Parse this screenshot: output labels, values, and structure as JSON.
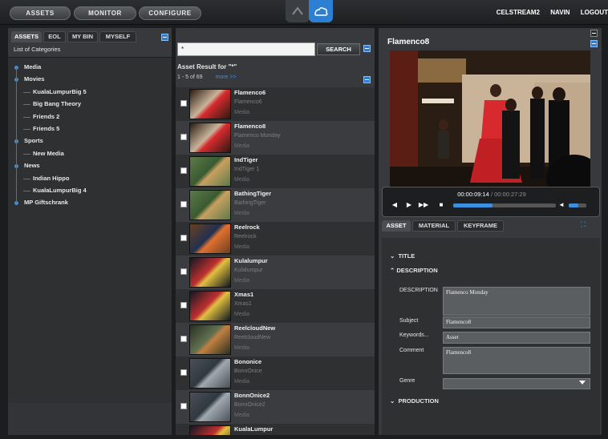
{
  "nav": {
    "buttons": [
      "ASSETS",
      "MONITOR",
      "CONFIGURE"
    ],
    "user_items": [
      "CELSTREAM2",
      "NAVIN",
      "LOGOUT"
    ]
  },
  "left_panel": {
    "tabs": [
      "ASSETS",
      "EOL",
      "MY BIN",
      "MYSELF"
    ],
    "heading": "List of Categories",
    "tree": [
      {
        "label": "Media",
        "level": 0
      },
      {
        "label": "Movies",
        "level": 0
      },
      {
        "label": "KualaLumpurBig 5",
        "level": 1
      },
      {
        "label": "Big Bang Theory",
        "level": 1
      },
      {
        "label": "Friends 2",
        "level": 1
      },
      {
        "label": "Friends 5",
        "level": 1
      },
      {
        "label": "Sports",
        "level": 0
      },
      {
        "label": "New Media",
        "level": 1
      },
      {
        "label": "News",
        "level": 0
      },
      {
        "label": "Indian Hippo",
        "level": 1
      },
      {
        "label": "KualaLumpurBig 4",
        "level": 1
      },
      {
        "label": "MP Giftschrank",
        "level": 0
      }
    ]
  },
  "middle_panel": {
    "search_value": "*",
    "search_label": "SEARCH",
    "result_heading": "Asset Result for \"*\"",
    "result_count": "1 - 5 of 69",
    "more_link": "more >>",
    "results": [
      {
        "name": "Flamenco6",
        "sub": "Flamenco6",
        "type": "Media",
        "thumb": "flamenco"
      },
      {
        "name": "Flamenco8",
        "sub": "Flamenco Monday",
        "type": "Media",
        "thumb": "flamenco"
      },
      {
        "name": "IndTiger",
        "sub": "IndTiger 1",
        "type": "Media",
        "thumb": "tiger"
      },
      {
        "name": "BathingTiger",
        "sub": "BathingTiger",
        "type": "Media",
        "thumb": "tiger"
      },
      {
        "name": "Reelrock",
        "sub": "Reelrock",
        "type": "Media",
        "thumb": "rock"
      },
      {
        "name": "Kulalumpur",
        "sub": "Kulalumpur",
        "type": "Media",
        "thumb": "city"
      },
      {
        "name": "Xmas1",
        "sub": "Xmas1",
        "type": "Media",
        "thumb": "city"
      },
      {
        "name": "ReelcloudNew",
        "sub": "ReelcloudNew",
        "type": "Media",
        "thumb": "crowd"
      },
      {
        "name": "Bononice",
        "sub": "BonnOnice",
        "type": "Media",
        "thumb": "ice"
      },
      {
        "name": "BonnOnice2",
        "sub": "BonnOnice2",
        "type": "Media",
        "thumb": "ice"
      },
      {
        "name": "KualaLumpur",
        "sub": "",
        "type": "",
        "thumb": "city"
      }
    ]
  },
  "right_panel": {
    "title": "Flamenco8",
    "timecode_current": "00:00:09:14",
    "timecode_separator": " / ",
    "timecode_total": "00:00:27:29",
    "progress": 0.38,
    "detail_tabs": [
      "ASSET",
      "MATERIAL",
      "KEYFRAME"
    ],
    "sections": {
      "title": "TITLE",
      "description": "DESCRIPTION",
      "production": "PRODUCTION"
    },
    "fields": {
      "description_label": "DESCRIPTION",
      "description_value": "Flamenco Monday",
      "subject_label": "Subject",
      "subject_value": "Flamenco8",
      "keywords_label": "Keywords...",
      "keywords_value": "Asset",
      "comment_label": "Comment",
      "comment_value": "Flamenco8",
      "genre_label": "Genre",
      "genre_value": ""
    }
  },
  "colors": {
    "accent": "#3b8fe0",
    "background": "#1b1d1f",
    "panel": "#37393c"
  }
}
